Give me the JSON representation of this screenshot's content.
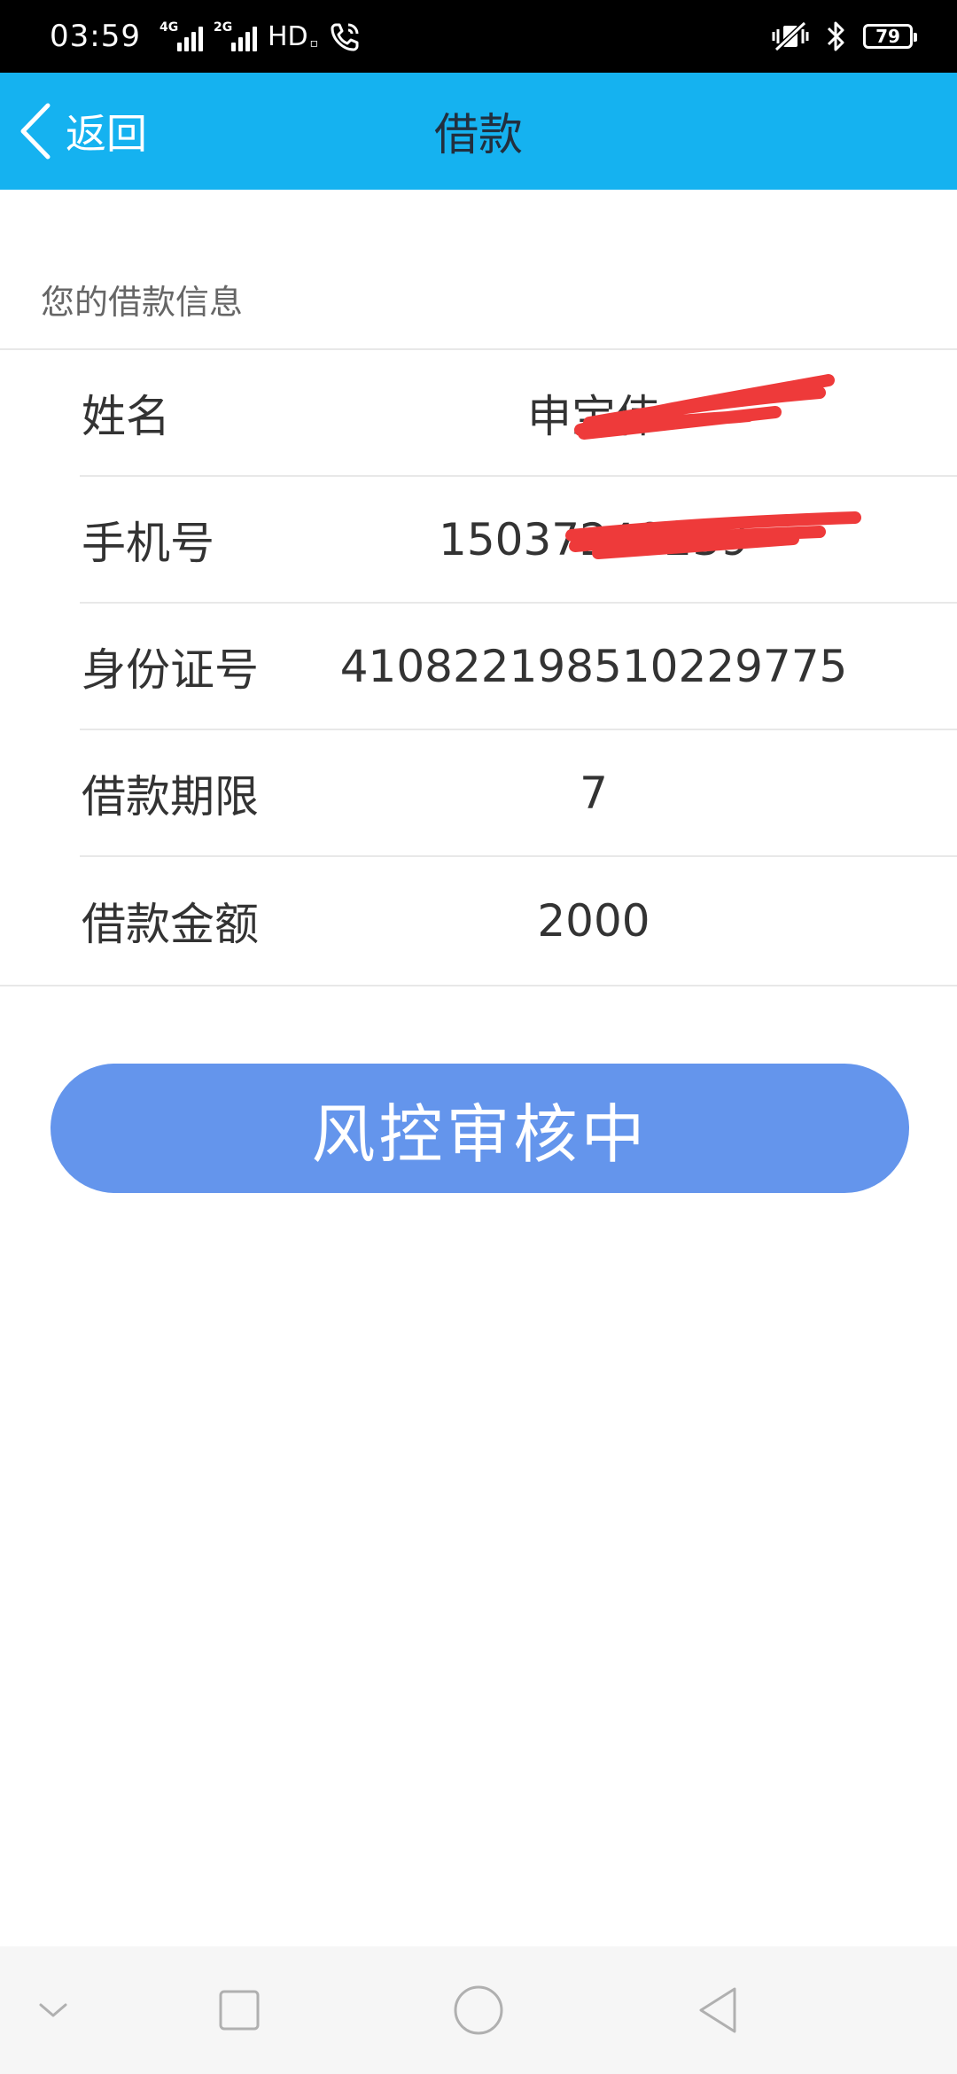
{
  "status_bar": {
    "time": "03:59",
    "signal_1_network": "4G",
    "signal_2_network": "2G",
    "hd_label": "HD",
    "battery_level": "79",
    "icons": [
      "signal-icon",
      "wifi-calling-icon",
      "vibrate-icon",
      "bluetooth-icon",
      "battery-icon"
    ]
  },
  "header": {
    "back_label": "返回",
    "title": "借款",
    "background_color": "#15b2f0"
  },
  "section": {
    "label": "您的借款信息"
  },
  "info_rows": [
    {
      "label": "姓名",
      "value": "申宝伟",
      "redacted": true
    },
    {
      "label": "手机号",
      "value": "15037240239",
      "redacted": true
    },
    {
      "label": "身份证号",
      "value": "410822198510229775",
      "redacted": false
    },
    {
      "label": "借款期限",
      "value": "7",
      "redacted": false
    },
    {
      "label": "借款金额",
      "value": "2000",
      "redacted": false
    }
  ],
  "status_button": {
    "label": "风控审核中",
    "color": "#6495ec"
  },
  "nav_bar": {
    "icons": [
      "hide-nav-icon",
      "recents-icon",
      "home-icon",
      "back-triangle-icon"
    ]
  }
}
